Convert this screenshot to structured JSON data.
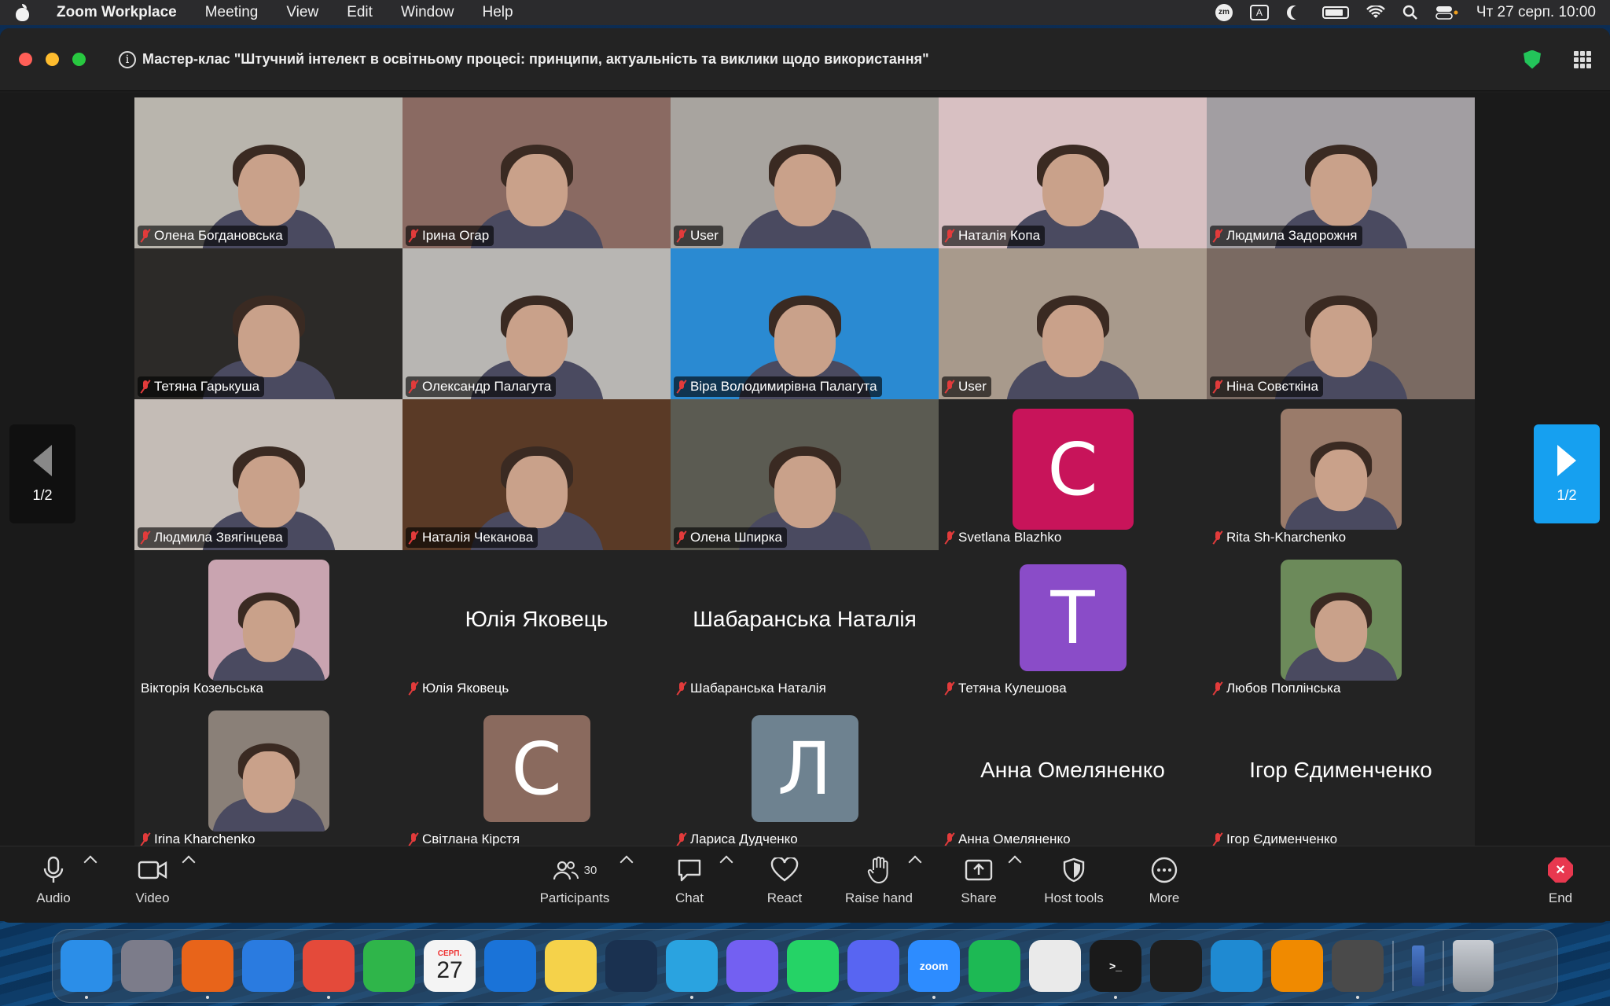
{
  "menubar": {
    "app_name": "Zoom Workplace",
    "menus": [
      "Meeting",
      "View",
      "Edit",
      "Window",
      "Help"
    ],
    "input_source": "A",
    "clock": "Чт 27 серп.  10:00"
  },
  "window": {
    "meeting_title": "Мастер-клас \"Штучний інтелект в освітньому процесі: принципи, актуальність та виклики щодо використання\""
  },
  "gallery": {
    "page_label_left": "1/2",
    "page_label_right": "1/2",
    "tiles": [
      {
        "name": "Олена Богдановська",
        "kind": "video",
        "bg": "#b9b5ad",
        "muted": true
      },
      {
        "name": "Ірина Огар",
        "kind": "video",
        "bg": "#8a6a62",
        "muted": true
      },
      {
        "name": "User",
        "kind": "video",
        "bg": "#a8a49f",
        "muted": true
      },
      {
        "name": "Наталія Копа",
        "kind": "video",
        "bg": "#d8c0c2",
        "muted": true
      },
      {
        "name": "Людмила Задорожня",
        "kind": "video",
        "bg": "#a29ea2",
        "muted": true
      },
      {
        "name": "Тетяна Гарькуша",
        "kind": "video",
        "bg": "#2c2a28",
        "muted": true
      },
      {
        "name": "Олександр Палагута",
        "kind": "video",
        "bg": "#b8b6b3",
        "muted": true
      },
      {
        "name": "Віра Володимирівна Палагута",
        "kind": "video",
        "bg": "#2a8ad2",
        "muted": true
      },
      {
        "name": "User",
        "kind": "video",
        "bg": "#a89a8c",
        "muted": true
      },
      {
        "name": "Ніна Совєткіна",
        "kind": "video",
        "bg": "#7a6a62",
        "muted": true
      },
      {
        "name": "Людмила Звягінцева",
        "kind": "video",
        "bg": "#c4bcb6",
        "muted": true
      },
      {
        "name": "Наталія Чеканова",
        "kind": "video",
        "bg": "#5a3a26",
        "muted": true
      },
      {
        "name": "Олена Шпирка",
        "kind": "video",
        "bg": "#5b5b52",
        "muted": true
      },
      {
        "name": "Svetlana Blazhko",
        "kind": "letter",
        "letter": "C",
        "color": "#c8145a",
        "muted": true
      },
      {
        "name": "Rita Sh-Kharchenko",
        "kind": "photo",
        "color": "#9a7b6a",
        "muted": true
      },
      {
        "name": "Вікторія Козельська",
        "kind": "photo",
        "color": "#c9a4b0",
        "muted": false
      },
      {
        "name": "Юлія Яковець",
        "kind": "text",
        "muted": true
      },
      {
        "name": "Шабаранська Наталія",
        "kind": "text",
        "muted": true
      },
      {
        "name": "Тетяна Кулешова",
        "kind": "letter",
        "letter": "T",
        "color": "#8a4cc8",
        "muted": true
      },
      {
        "name": "Любов Поплінська",
        "kind": "photo",
        "color": "#6c8a5a",
        "muted": true
      },
      {
        "name": "Irina Kharchenko",
        "kind": "photo",
        "color": "#8a8078",
        "muted": true
      },
      {
        "name": "Світлана Кірстя",
        "kind": "letter",
        "letter": "C",
        "color": "#8a6a5e",
        "muted": true
      },
      {
        "name": "Лариса Дудченко",
        "kind": "letter",
        "letter": "Л",
        "color": "#6e8290",
        "muted": true
      },
      {
        "name": "Анна Омеляненко",
        "kind": "text",
        "muted": true
      },
      {
        "name": "Ігор Єдименченко",
        "kind": "text",
        "muted": true
      }
    ]
  },
  "toolbar": {
    "audio": "Audio",
    "video": "Video",
    "participants": "Participants",
    "participants_count": "30",
    "chat": "Chat",
    "react": "React",
    "raise_hand": "Raise hand",
    "share": "Share",
    "host_tools": "Host tools",
    "more": "More",
    "end": "End"
  },
  "dock": {
    "apps": [
      {
        "name": "Finder",
        "color": "#2b8ee8",
        "label": ""
      },
      {
        "name": "Launchpad",
        "color": "#7c7c8a",
        "label": ""
      },
      {
        "name": "Firefox",
        "color": "#e8641a",
        "label": ""
      },
      {
        "name": "Safari",
        "color": "#2a7be0",
        "label": ""
      },
      {
        "name": "Chrome",
        "color": "#e44a3a",
        "label": ""
      },
      {
        "name": "Numbers",
        "color": "#2fb54a",
        "label": ""
      },
      {
        "name": "Calendar",
        "color": "#f4f4f4",
        "label": "27"
      },
      {
        "name": "Trello",
        "color": "#1a73d8",
        "label": ""
      },
      {
        "name": "Notes",
        "color": "#f5d24a",
        "label": ""
      },
      {
        "name": "Steam",
        "color": "#1a3150",
        "label": ""
      },
      {
        "name": "Telegram",
        "color": "#2aa3e0",
        "label": ""
      },
      {
        "name": "Viber",
        "color": "#7360f2",
        "label": ""
      },
      {
        "name": "WhatsApp",
        "color": "#25d366",
        "label": ""
      },
      {
        "name": "Discord",
        "color": "#5865f2",
        "label": ""
      },
      {
        "name": "Zoom",
        "color": "#2d8cff",
        "label": "zoom"
      },
      {
        "name": "Spotify",
        "color": "#1db954",
        "label": ""
      },
      {
        "name": "Robot",
        "color": "#eaeaea",
        "label": ""
      },
      {
        "name": "Terminal",
        "color": "#1a1a1a",
        "label": ">_"
      },
      {
        "name": "Figma",
        "color": "#1e1e1e",
        "label": ""
      },
      {
        "name": "VS Code",
        "color": "#1f8ad2",
        "label": ""
      },
      {
        "name": "VLC",
        "color": "#f08a00",
        "label": ""
      },
      {
        "name": "Sublime Text",
        "color": "#4a4a4a",
        "label": ""
      }
    ],
    "calendar_month": "СЕРП."
  }
}
